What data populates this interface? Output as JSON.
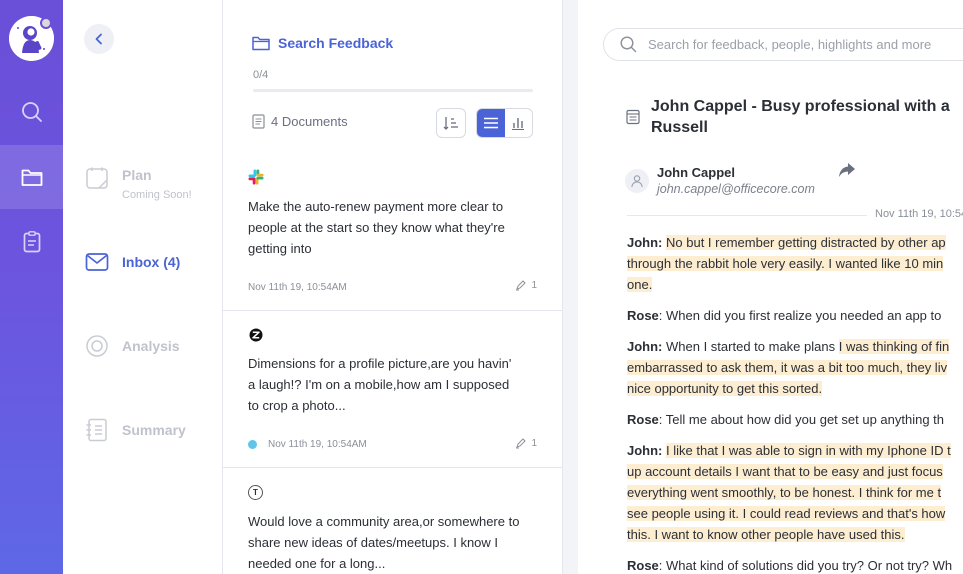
{
  "sidebar": {
    "items": [
      {
        "label": "Plan",
        "sub": "Coming Soon!"
      },
      {
        "label": "Inbox (4)"
      },
      {
        "label": "Analysis"
      },
      {
        "label": "Summary"
      }
    ]
  },
  "list": {
    "title": "Search Feedback",
    "progress_label": "0/4",
    "progress_value": 0,
    "documents_label": "4 Documents",
    "cards": [
      {
        "source_icon": "slack-icon",
        "text": [
          "Make the auto-renew payment more clear to",
          "people at the start so they know what they're",
          "getting into"
        ],
        "date": "Nov 11th 19, 10:54AM",
        "highlights": "1"
      },
      {
        "source_icon": "zendesk-icon",
        "text": [
          "Dimensions for a profile picture,are you havin'",
          "a laugh!? I'm on a mobile,how am I supposed",
          "to crop a photo..."
        ],
        "date": "Nov 11th 19, 10:54AM",
        "highlights": "1"
      },
      {
        "source_icon": "typeform-icon",
        "source_letter": "T",
        "text": [
          "Would love a community area,or somewhere to",
          "share new ideas of dates/meetups. I know I",
          "needed one for a long..."
        ]
      }
    ]
  },
  "detail": {
    "search_placeholder": "Search for feedback, people, highlights and more",
    "title_line1": "John Cappel - Busy professional with a",
    "title_line2": "Russell",
    "person_name": "John Cappel",
    "person_email": "john.cappel@officecore.com",
    "date": "Nov 11th 19, 10:54",
    "transcript": [
      {
        "speaker": "John:",
        "segments": [
          {
            "t": "No but I remember getting distracted by other ap",
            "hl": true
          },
          {
            "t": "through the rabbit hole very easily. I wanted like 10 min",
            "hl": true
          },
          {
            "t": "one.",
            "hl": true
          }
        ]
      },
      {
        "speaker": "Rose",
        "segments": [
          {
            "t": ": When did you first realize you needed an app to",
            "hl": false
          }
        ]
      },
      {
        "speaker": "John:",
        "segments": [
          {
            "t": "When I started to make plans ",
            "hl": false,
            "inline": "I was thinking of fin"
          },
          {
            "t": "embarrassed to ask them, it was a bit too much, they liv",
            "hl": true
          },
          {
            "t": "nice opportunity to get this sorted.",
            "hl": true
          }
        ]
      },
      {
        "speaker": "Rose",
        "segments": [
          {
            "t": ": Tell me about how did you get set up anything th",
            "hl": false
          }
        ]
      },
      {
        "speaker": "John:",
        "segments": [
          {
            "t": "I like that I was able to sign in with my Iphone ID t",
            "hl": true
          },
          {
            "t": "up account details I want that to be easy and just focus",
            "hl": true
          },
          {
            "t": "everything went smoothly, to be honest. I think for me t",
            "hl": true
          },
          {
            "t": "see people using it. I could read reviews and that's how",
            "hl": true
          },
          {
            "t": "this. I want to know other people have used this.",
            "hl": true
          }
        ]
      },
      {
        "speaker": "Rose",
        "segments": [
          {
            "t": ": What kind of solutions did you try? Or not try? Wh",
            "hl": false
          }
        ]
      }
    ]
  }
}
